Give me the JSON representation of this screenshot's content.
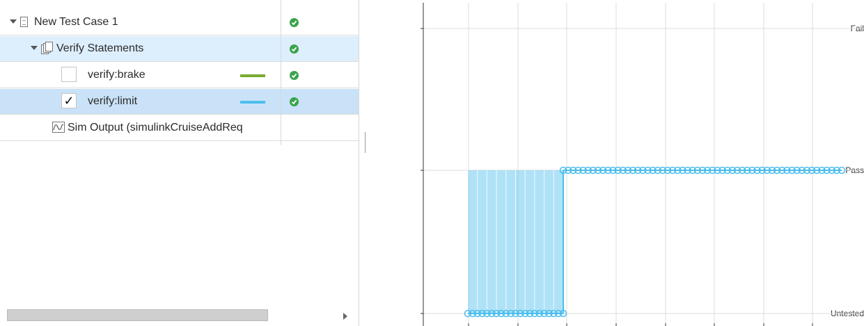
{
  "tree": {
    "rows": [
      {
        "label": "New Test Case 1",
        "status": "pass-icon"
      },
      {
        "label": "Verify Statements",
        "status": "pass-icon"
      },
      {
        "label": "verify:brake",
        "checked": false,
        "color": "#77ac30",
        "status": "pass-icon"
      },
      {
        "label": "verify:limit",
        "checked": true,
        "color": "#4dbeee",
        "status": "pass-icon"
      },
      {
        "label": "Sim Output (simulinkCruiseAddReq"
      }
    ],
    "check_mark": "✓"
  },
  "colors": {
    "pass": "#3aa34b",
    "limit_signal": "#4dbeee",
    "brake_signal": "#77ac30",
    "row_highlight": "#ddeefc",
    "row_selected": "#c9e2f7"
  },
  "chart_data": {
    "type": "line",
    "y_categories": [
      "Untested",
      "Pass",
      "Fail"
    ],
    "ylabels": {
      "fail": "Fail",
      "pass": "Pass",
      "untested": "Untested"
    },
    "grid": true,
    "series": [
      {
        "color": "#4dbeee",
        "segments": [
          {
            "state": "Untested",
            "points": 21,
            "filled_to": "Pass"
          },
          {
            "state": "Pass",
            "points": 57
          }
        ]
      }
    ]
  }
}
